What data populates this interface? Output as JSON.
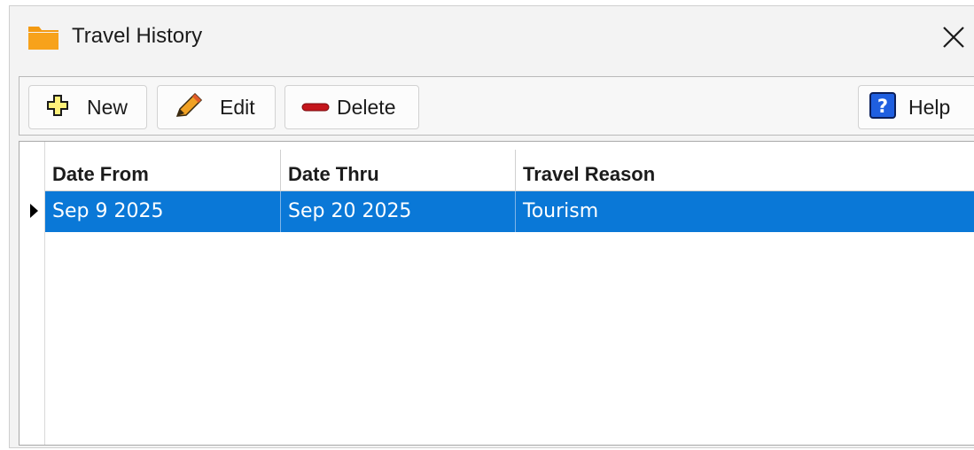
{
  "window": {
    "title": "Travel History"
  },
  "icons": {
    "app": "folder-icon",
    "close": "close-icon",
    "new": "plus-icon",
    "edit": "pencil-icon",
    "delete": "minus-icon",
    "help": "question-icon"
  },
  "colors": {
    "selection": "#0a78d7",
    "folder": "#f7a21b"
  },
  "toolbar": {
    "new_label": "New",
    "edit_label": "Edit",
    "delete_label": "Delete",
    "help_label": "Help"
  },
  "grid": {
    "columns": [
      "Date From",
      "Date Thru",
      "Travel Reason"
    ],
    "rows": [
      {
        "date_from": "Sep 9 2025",
        "date_thru": "Sep 20 2025",
        "reason": "Tourism"
      }
    ]
  }
}
